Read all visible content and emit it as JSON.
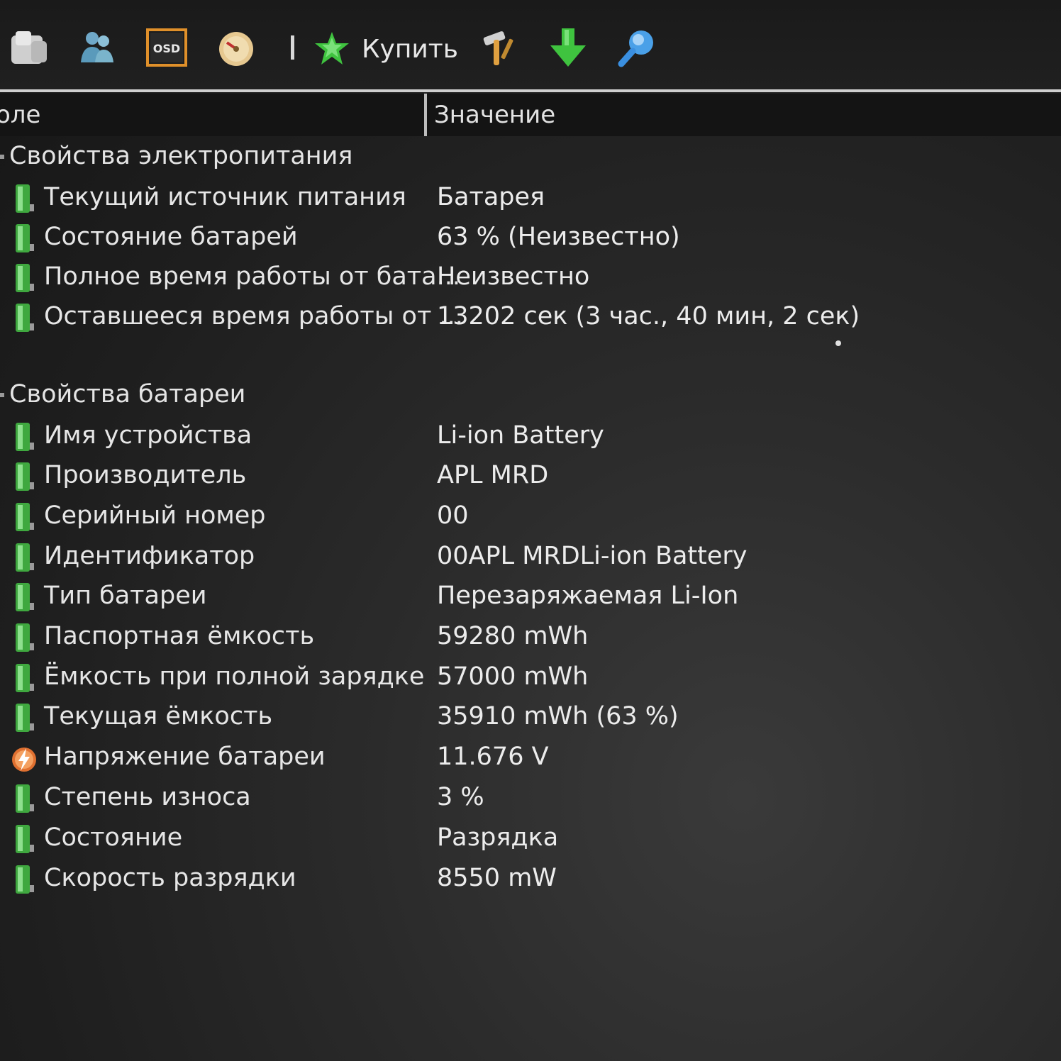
{
  "toolbar": {
    "buy_label": "Купить",
    "osd_label": "OSD",
    "icons": [
      "report-icon",
      "user-icon",
      "osd-icon",
      "gauge-icon",
      "buy-star-icon",
      "tools-icon",
      "download-arrow-icon",
      "search-icon"
    ],
    "colors": {
      "green": "#3fc33f",
      "blue": "#3a8fe0",
      "orange": "#e0902a"
    }
  },
  "columns": {
    "field": "оле",
    "value": "Значение"
  },
  "groups": [
    {
      "title": "Свойства электропитания",
      "rows": [
        {
          "label": "Текущий источник питания",
          "value": "Батарея",
          "icon": "battery-icon"
        },
        {
          "label": "Состояние батарей",
          "value": "63 % (Неизвестно)",
          "icon": "battery-icon"
        },
        {
          "label": "Полное время работы от бата...",
          "value": "Неизвестно",
          "icon": "battery-icon"
        },
        {
          "label": "Оставшееся время работы от ...",
          "value": "13202 сек (3 час., 40 мин, 2 сек)",
          "icon": "battery-icon"
        }
      ]
    },
    {
      "title": "Свойства батареи",
      "rows": [
        {
          "label": "Имя устройства",
          "value": "Li-ion Battery",
          "icon": "battery-icon"
        },
        {
          "label": "Производитель",
          "value": "APL MRD",
          "icon": "battery-icon"
        },
        {
          "label": "Серийный номер",
          "value": "00",
          "icon": "battery-icon"
        },
        {
          "label": "Идентификатор",
          "value": "00APL MRDLi-ion Battery",
          "icon": "battery-icon"
        },
        {
          "label": "Тип батареи",
          "value": "Перезаряжаемая Li-Ion",
          "icon": "battery-icon"
        },
        {
          "label": "Паспортная ёмкость",
          "value": "59280 mWh",
          "icon": "battery-icon"
        },
        {
          "label": "Ёмкость при полной зарядке",
          "value": "57000 mWh",
          "icon": "battery-icon"
        },
        {
          "label": "Текущая ёмкость",
          "value": "35910 mWh  (63 %)",
          "icon": "battery-icon"
        },
        {
          "label": "Напряжение батареи",
          "value": "11.676 V",
          "icon": "voltage-lightning-icon"
        },
        {
          "label": "Степень износа",
          "value": "3 %",
          "icon": "battery-icon"
        },
        {
          "label": "Состояние",
          "value": "Разрядка",
          "icon": "battery-icon"
        },
        {
          "label": "Скорость разрядки",
          "value": "8550 mW",
          "icon": "battery-icon"
        }
      ]
    }
  ]
}
